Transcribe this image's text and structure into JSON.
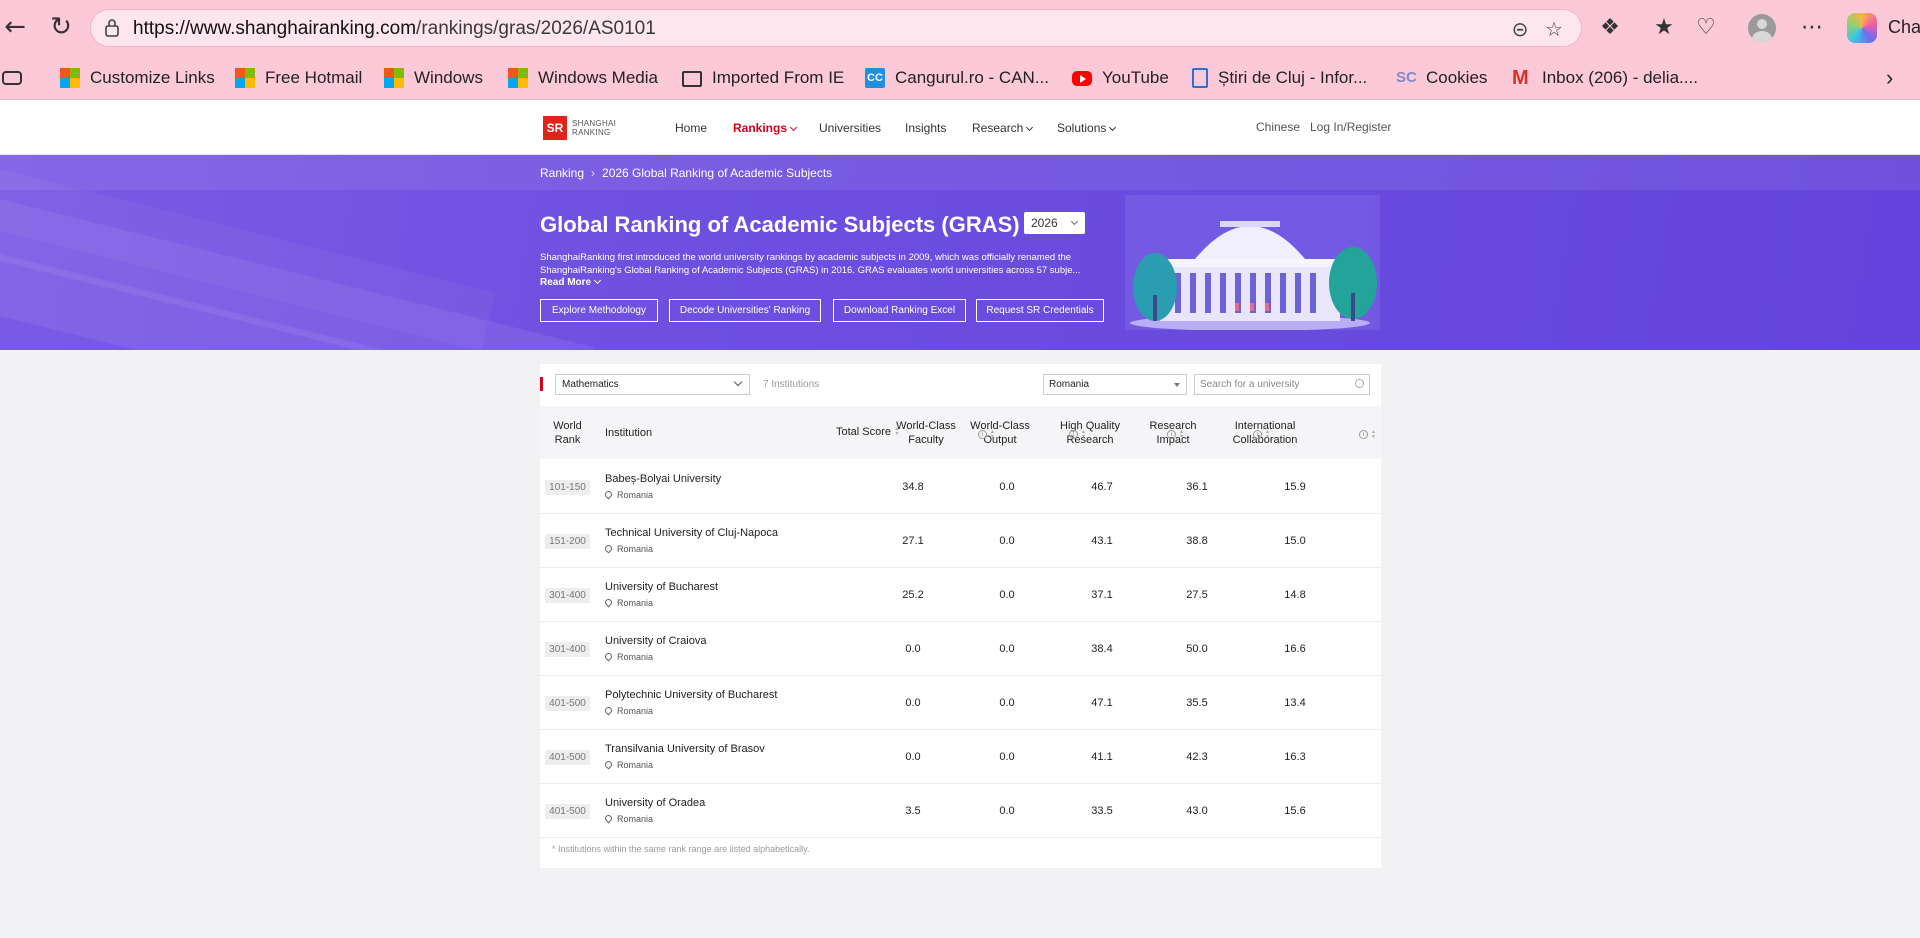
{
  "browser": {
    "url_domain": "https://www.shanghairanking.com",
    "url_path": "/rankings/gras/2026/AS0101",
    "chat_label": "Chat",
    "bookmarks": [
      {
        "label": "Customize Links",
        "icon": "ms-logo-icon"
      },
      {
        "label": "Free Hotmail",
        "icon": "ms-logo-icon"
      },
      {
        "label": "Windows",
        "icon": "ms-logo-icon"
      },
      {
        "label": "Windows Media",
        "icon": "ms-logo-icon"
      },
      {
        "label": "Imported From IE",
        "icon": "folder-icon"
      },
      {
        "label": "Cangurul.ro - CAN...",
        "icon": "cc-icon"
      },
      {
        "label": "YouTube",
        "icon": "youtube-icon"
      },
      {
        "label": "Știri de Cluj - Infor...",
        "icon": "doc-icon"
      },
      {
        "label": "Cookies",
        "icon": "sc-icon"
      },
      {
        "label": "Inbox (206) - delia....",
        "icon": "gmail-icon"
      }
    ]
  },
  "site": {
    "logo_line1": "SHANGHAI",
    "logo_line2": "RANKING",
    "logo_mark": "SR",
    "nav": [
      {
        "label": "Home"
      },
      {
        "label": "Rankings",
        "active": true
      },
      {
        "label": "Universities"
      },
      {
        "label": "Insights"
      },
      {
        "label": "Research"
      },
      {
        "label": "Solutions"
      }
    ],
    "lang": "Chinese",
    "login": "Log In/Register"
  },
  "banner": {
    "breadcrumb_root": "Ranking",
    "breadcrumb_current": "2026 Global Ranking of Academic Subjects",
    "title": "Global Ranking of Academic Subjects (GRAS)",
    "year": "2026",
    "description": "ShanghaiRanking first introduced the world university rankings by academic subjects in 2009, which was officially renamed the ShanghaiRanking's Global Ranking of Academic Subjects (GRAS) in 2016. GRAS evaluates world universities across 57 subje...",
    "read_more": "Read More",
    "buttons": [
      "Explore Methodology",
      "Decode Universities' Ranking",
      "Download Ranking Excel",
      "Request SR Credentials"
    ]
  },
  "filters": {
    "subject": "Mathematics",
    "count": "7 Institutions",
    "country": "Romania",
    "search_placeholder": "Search for a university"
  },
  "table": {
    "headers": {
      "rank": "World Rank",
      "institution": "Institution",
      "total": "Total Score",
      "faculty": "World-Class Faculty",
      "output": "World-Class Output",
      "research": "High Quality Research",
      "impact": "Research Impact",
      "collab": "International Collaboration"
    },
    "rows": [
      {
        "rank": "101-150",
        "name": "Babeș-Bolyai University",
        "country": "Romania",
        "faculty": "34.8",
        "output": "0.0",
        "research": "46.7",
        "impact": "36.1",
        "collab": "15.9"
      },
      {
        "rank": "151-200",
        "name": "Technical University of Cluj-Napoca",
        "country": "Romania",
        "faculty": "27.1",
        "output": "0.0",
        "research": "43.1",
        "impact": "38.8",
        "collab": "15.0"
      },
      {
        "rank": "301-400",
        "name": "University of Bucharest",
        "country": "Romania",
        "faculty": "25.2",
        "output": "0.0",
        "research": "37.1",
        "impact": "27.5",
        "collab": "14.8"
      },
      {
        "rank": "301-400",
        "name": "University of Craiova",
        "country": "Romania",
        "faculty": "0.0",
        "output": "0.0",
        "research": "38.4",
        "impact": "50.0",
        "collab": "16.6"
      },
      {
        "rank": "401-500",
        "name": "Polytechnic University of Bucharest",
        "country": "Romania",
        "faculty": "0.0",
        "output": "0.0",
        "research": "47.1",
        "impact": "35.5",
        "collab": "13.4"
      },
      {
        "rank": "401-500",
        "name": "Transilvania University of Brasov",
        "country": "Romania",
        "faculty": "0.0",
        "output": "0.0",
        "research": "41.1",
        "impact": "42.3",
        "collab": "16.3"
      },
      {
        "rank": "401-500",
        "name": "University of Oradea",
        "country": "Romania",
        "faculty": "3.5",
        "output": "0.0",
        "research": "33.5",
        "impact": "43.0",
        "collab": "15.6"
      }
    ],
    "footnote": "* Institutions within the same rank range are listed alphabetically."
  },
  "colors": {
    "accent": "#d0021b",
    "banner": "#6c4fe0",
    "browser": "#fbc9d8"
  }
}
